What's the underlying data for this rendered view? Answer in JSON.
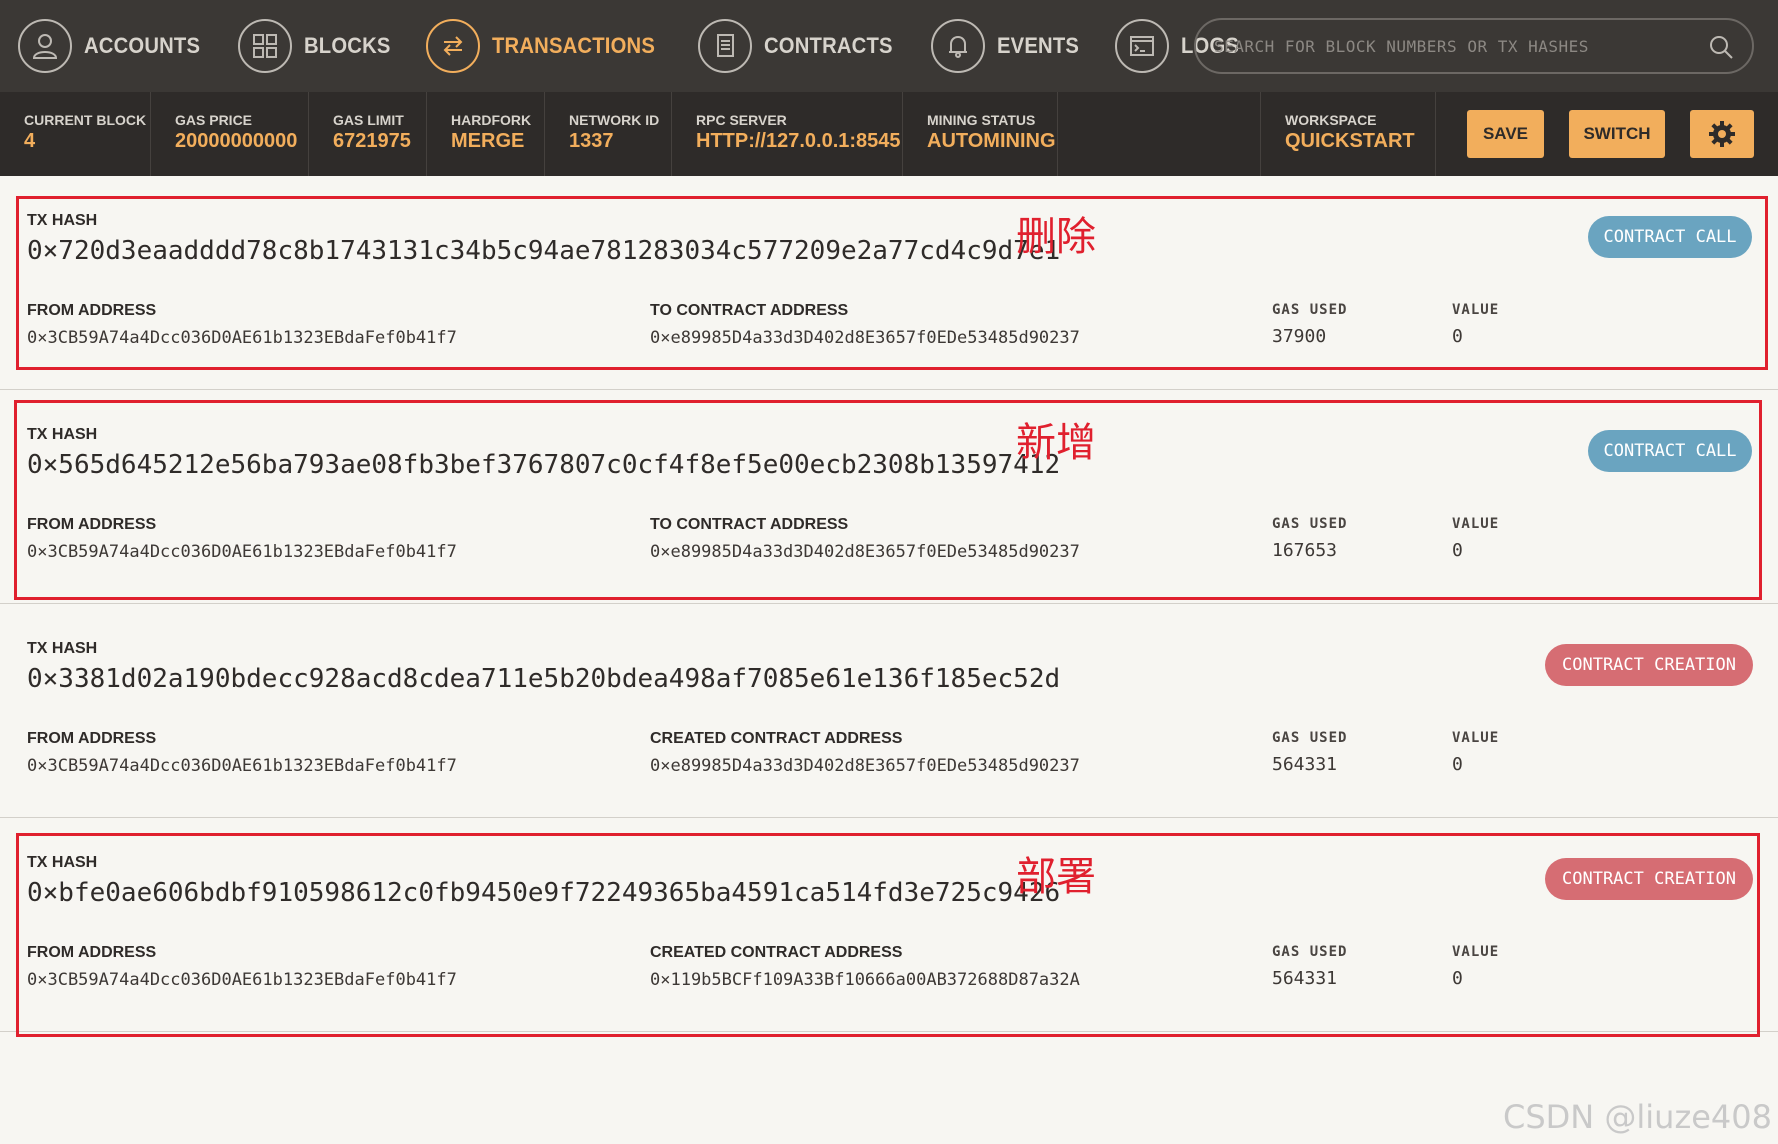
{
  "nav": {
    "items": [
      {
        "label": "ACCOUNTS",
        "icon": "user-icon"
      },
      {
        "label": "BLOCKS",
        "icon": "blocks-icon"
      },
      {
        "label": "TRANSACTIONS",
        "icon": "transfer-icon",
        "active": true
      },
      {
        "label": "CONTRACTS",
        "icon": "document-icon"
      },
      {
        "label": "EVENTS",
        "icon": "bell-icon"
      },
      {
        "label": "LOGS",
        "icon": "terminal-icon"
      }
    ],
    "search_placeholder": "SEARCH FOR BLOCK NUMBERS OR TX HASHES"
  },
  "status": {
    "current_block": {
      "label": "CURRENT BLOCK",
      "value": "4"
    },
    "gas_price": {
      "label": "GAS PRICE",
      "value": "20000000000"
    },
    "gas_limit": {
      "label": "GAS LIMIT",
      "value": "6721975"
    },
    "hardfork": {
      "label": "HARDFORK",
      "value": "MERGE"
    },
    "network_id": {
      "label": "NETWORK ID",
      "value": "1337"
    },
    "rpc_server": {
      "label": "RPC SERVER",
      "value": "HTTP://127.0.0.1:8545"
    },
    "mining_status": {
      "label": "MINING STATUS",
      "value": "AUTOMINING"
    },
    "workspace": {
      "label": "WORKSPACE",
      "value": "QUICKSTART"
    },
    "save_label": "SAVE",
    "switch_label": "SWITCH"
  },
  "labels": {
    "tx_hash": "TX HASH",
    "from_address": "FROM ADDRESS",
    "to_contract_address": "TO CONTRACT ADDRESS",
    "created_contract_address": "CREATED CONTRACT ADDRESS",
    "gas_used": "GAS USED",
    "value": "VALUE"
  },
  "transactions": [
    {
      "hash": "0×720d3eaadddd78c8b1743131c34b5c94ae781283034c577209e2a77cd4c9d7e1",
      "type": "CONTRACT CALL",
      "from": "0×3CB59A74a4Dcc036D0AE61b1323EBdaFef0b41f7",
      "to_label": "TO CONTRACT ADDRESS",
      "to": "0×e89985D4a33d3D402d8E3657f0EDe53485d90237",
      "gas_used": "37900",
      "value": "0",
      "annotation": "删除"
    },
    {
      "hash": "0×565d645212e56ba793ae08fb3bef3767807c0cf4f8ef5e00ecb2308b13597412",
      "type": "CONTRACT CALL",
      "from": "0×3CB59A74a4Dcc036D0AE61b1323EBdaFef0b41f7",
      "to_label": "TO CONTRACT ADDRESS",
      "to": "0×e89985D4a33d3D402d8E3657f0EDe53485d90237",
      "gas_used": "167653",
      "value": "0",
      "annotation": "新增"
    },
    {
      "hash": "0×3381d02a190bdecc928acd8cdea711e5b20bdea498af7085e61e136f185ec52d",
      "type": "CONTRACT CREATION",
      "from": "0×3CB59A74a4Dcc036D0AE61b1323EBdaFef0b41f7",
      "to_label": "CREATED CONTRACT ADDRESS",
      "to": "0×e89985D4a33d3D402d8E3657f0EDe53485d90237",
      "gas_used": "564331",
      "value": "0",
      "annotation": ""
    },
    {
      "hash": "0×bfe0ae606bdbf910598612c0fb9450e9f72249365ba4591ca514fd3e725c9426",
      "type": "CONTRACT CREATION",
      "from": "0×3CB59A74a4Dcc036D0AE61b1323EBdaFef0b41f7",
      "to_label": "CREATED CONTRACT ADDRESS",
      "to": "0×119b5BCFf109A33Bf10666a00AB372688D87a32A",
      "gas_used": "564331",
      "value": "0",
      "annotation": "部署"
    }
  ],
  "colors": {
    "accent": "#f2ae5c",
    "nav_bg": "#3b3835",
    "status_bg": "#2e2b29",
    "contract_call": "#6aa4c0",
    "contract_creation": "#d66d73",
    "annotation_red": "#e0202e"
  },
  "watermark": "CSDN @liuze408"
}
